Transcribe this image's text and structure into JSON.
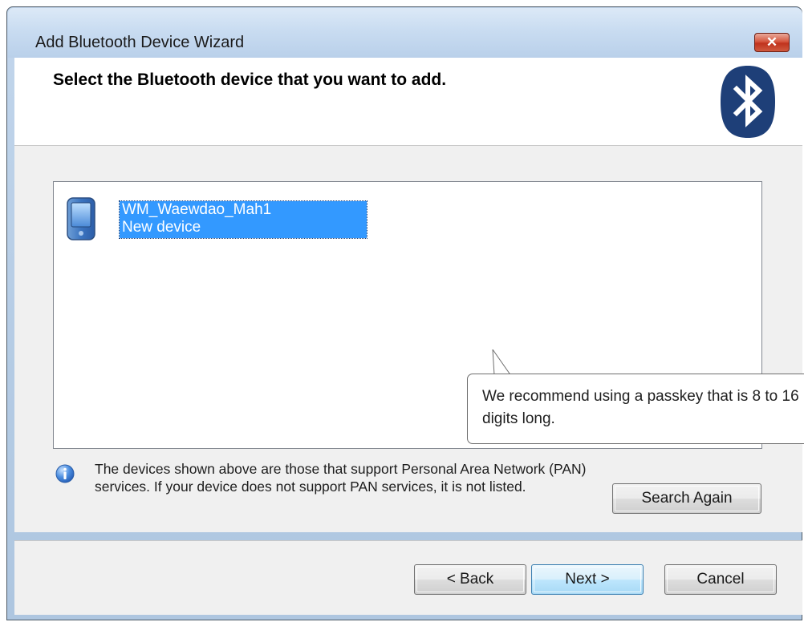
{
  "window": {
    "title": "Add Bluetooth Device Wizard",
    "close_glyph": "✕"
  },
  "header": {
    "instruction": "Select the Bluetooth device that you want to add.",
    "logo_icon": "bluetooth-logo-icon"
  },
  "device_list": {
    "items": [
      {
        "name": "WM_Waewdao_Mah1",
        "status": "New device",
        "icon": "pocket-pc-device-icon",
        "selected": true
      }
    ]
  },
  "tooltip": {
    "text": "We recommend using a passkey that is 8 to 16 digits long."
  },
  "info": {
    "icon": "info-icon",
    "text": "The devices shown above are those that support Personal Area Network (PAN) services. If your device does not support PAN services, it is not listed."
  },
  "buttons": {
    "search_again": "Search Again",
    "back": "< Back",
    "next": "Next >",
    "cancel": "Cancel"
  },
  "colors": {
    "selection": "#3399ff",
    "bluetooth_blue": "#1e3f78",
    "close_red": "#c7402b"
  }
}
